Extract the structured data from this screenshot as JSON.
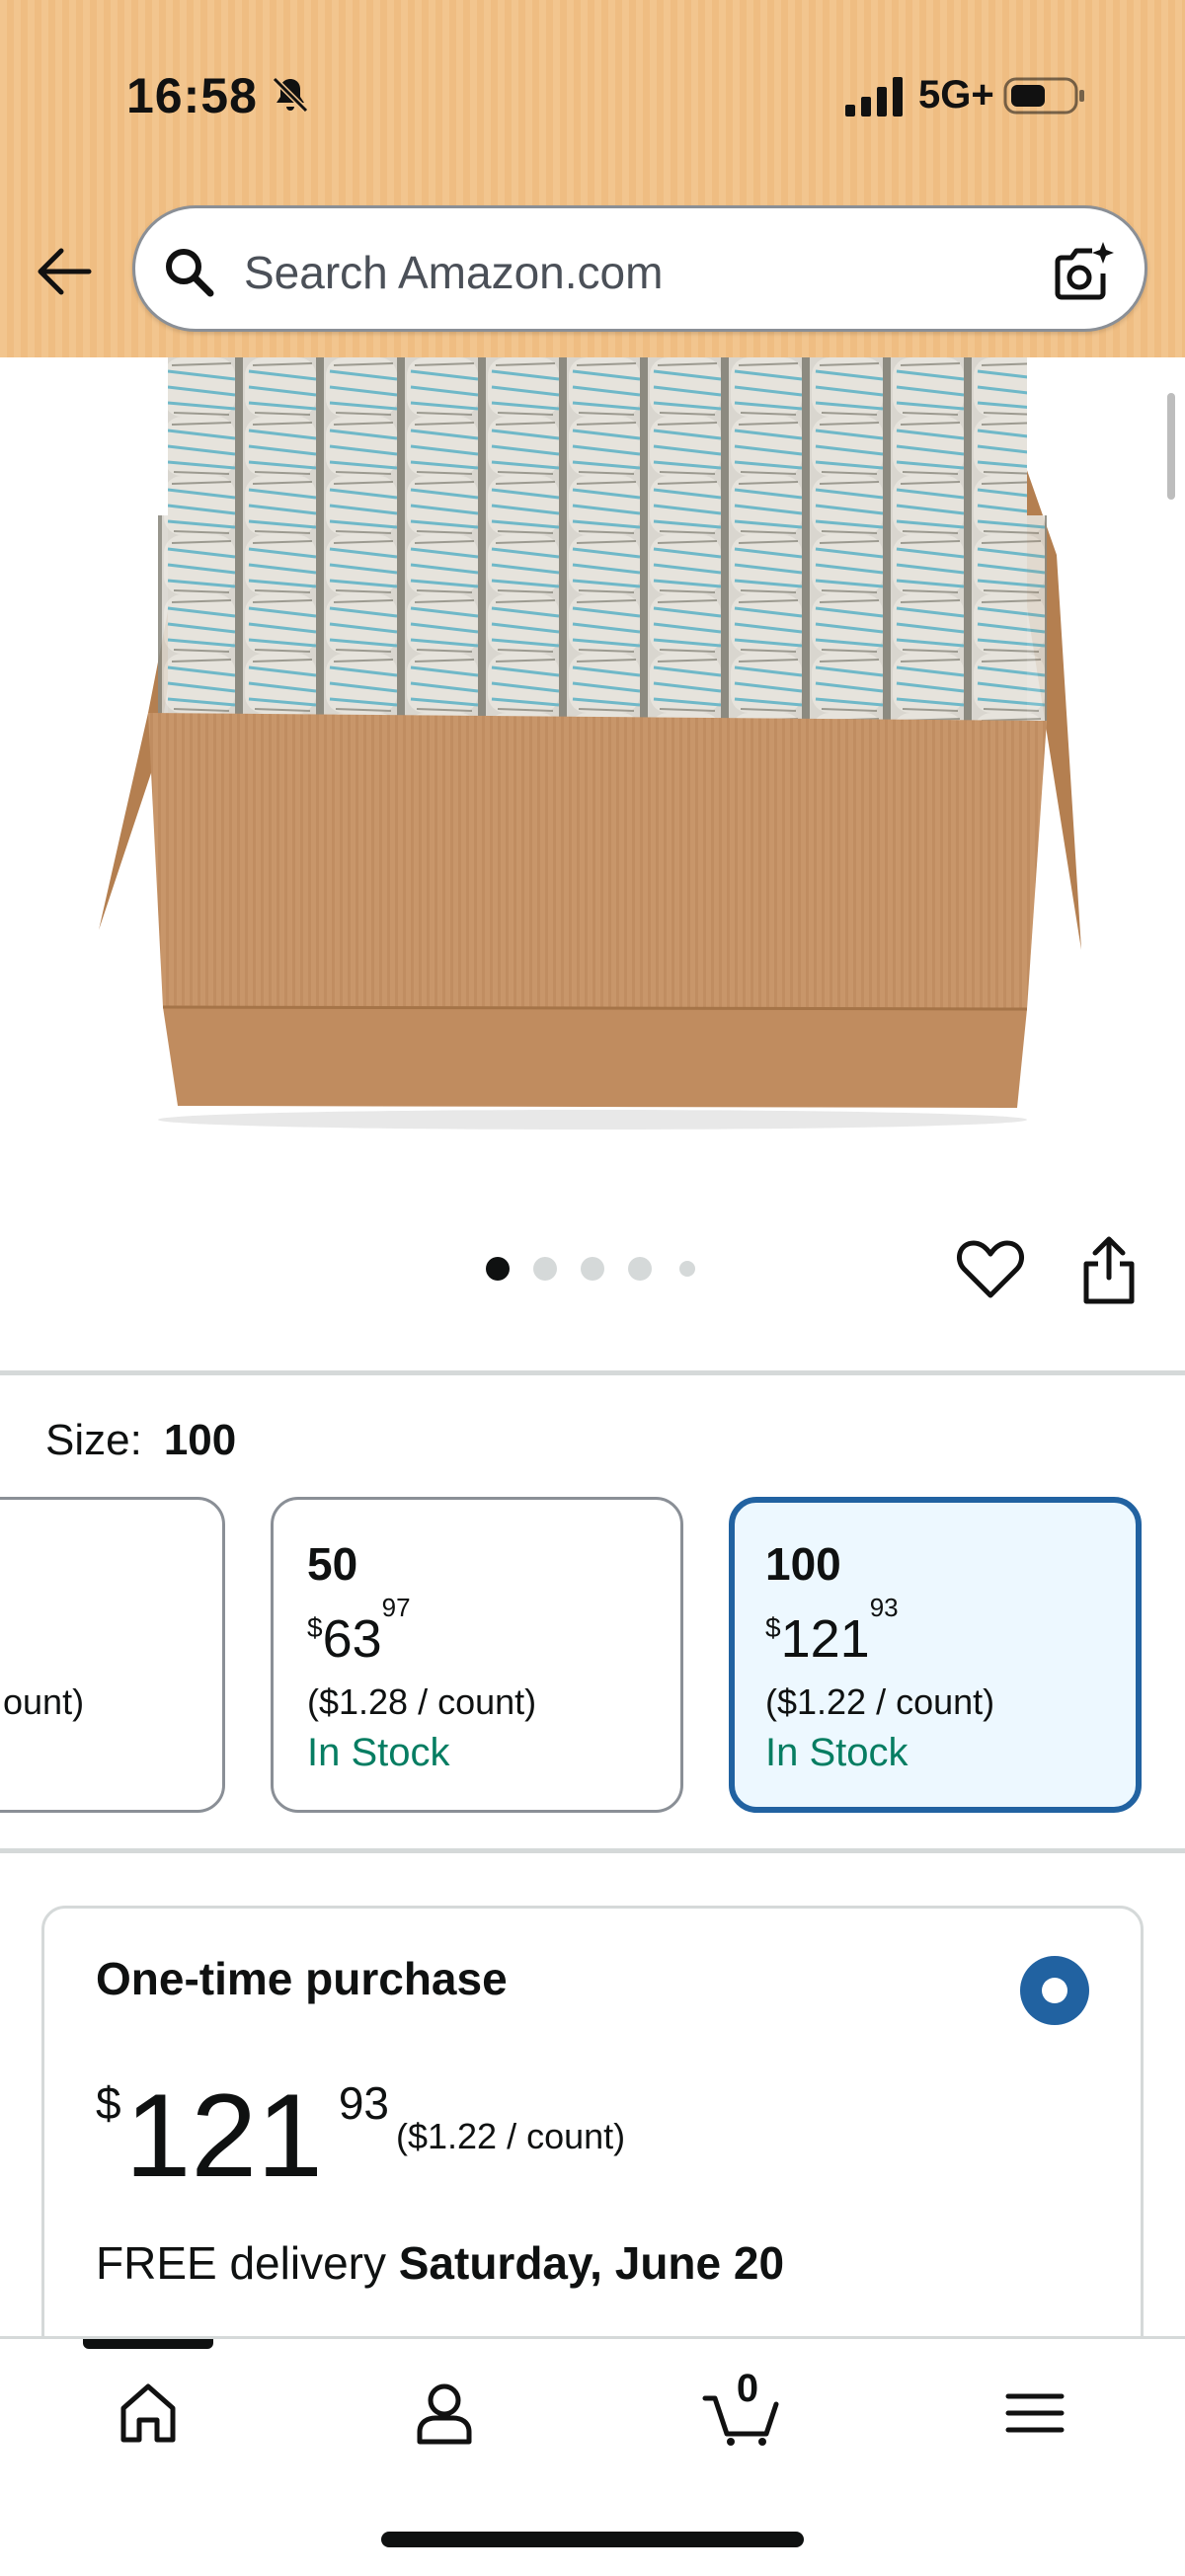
{
  "status_bar": {
    "time": "16:58",
    "network": "5G+",
    "icons": [
      "bell-off-icon",
      "signal-bars-icon",
      "battery-icon"
    ]
  },
  "header": {
    "search_placeholder": "Search Amazon.com",
    "icons": [
      "back-arrow-icon",
      "search-icon",
      "camera-search-icon"
    ]
  },
  "gallery": {
    "image_description_icon": "product-photo",
    "image_count": 5,
    "active_index": 0,
    "icons": [
      "heart-icon",
      "share-icon"
    ]
  },
  "size": {
    "label": "Size:",
    "selected": "100",
    "options": [
      {
        "count": "",
        "price_whole": "",
        "price_cents": "",
        "unit_price": "ount)",
        "stock": ""
      },
      {
        "count": "50",
        "currency": "$",
        "price_whole": "63",
        "price_cents": "97",
        "unit_price": "($1.28 / count)",
        "stock": "In Stock"
      },
      {
        "count": "100",
        "currency": "$",
        "price_whole": "121",
        "price_cents": "93",
        "unit_price": "($1.22 / count)",
        "stock": "In Stock"
      }
    ]
  },
  "purchase": {
    "title": "One-time purchase",
    "currency": "$",
    "price_whole": "121",
    "price_cents": "93",
    "unit_price": "($1.22 / count)",
    "delivery_prefix": "FREE delivery",
    "delivery_date": "Saturday, June 20"
  },
  "bottom_nav": {
    "items": [
      "home-icon",
      "account-icon",
      "cart-icon",
      "menu-icon"
    ],
    "cart_count": "0"
  },
  "colors": {
    "header_bg": "#f2c58e",
    "selected_border": "#2162a1",
    "selected_bg": "#edf8ff",
    "in_stock": "#067d62"
  }
}
